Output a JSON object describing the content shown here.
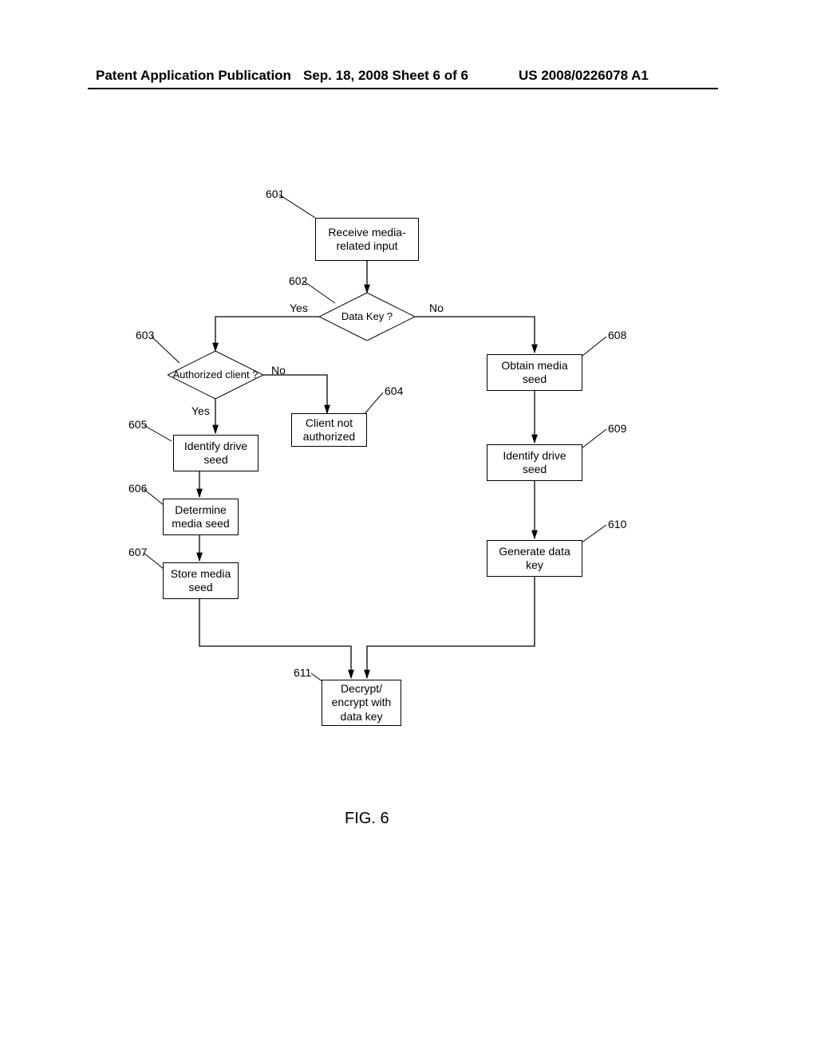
{
  "header": {
    "left": "Patent Application Publication",
    "center": "Sep. 18, 2008  Sheet 6 of 6",
    "right": "US 2008/0226078 A1"
  },
  "nodes": {
    "n601": "Receive media-related input",
    "n602": "Data Key ?",
    "n603": "Authorized client ?",
    "n604": "Client not authorized",
    "n605": "Identify drive seed",
    "n606": "Determine media seed",
    "n607": "Store media seed",
    "n608": "Obtain media seed",
    "n609": "Identify drive seed",
    "n610": "Generate data key",
    "n611": "Decrypt/ encrypt with data key"
  },
  "labels": {
    "l601": "601",
    "l602": "602",
    "l603": "603",
    "l604": "604",
    "l605": "605",
    "l606": "606",
    "l607": "607",
    "l608": "608",
    "l609": "609",
    "l610": "610",
    "l611": "611",
    "yes1": "Yes",
    "no1": "No",
    "yes2": "Yes",
    "no2": "No"
  },
  "figcaption": "FIG. 6",
  "chart_data": {
    "type": "flowchart",
    "title": "FIG. 6",
    "nodes": [
      {
        "id": "601",
        "label": "Receive media-related input",
        "shape": "process"
      },
      {
        "id": "602",
        "label": "Data Key ?",
        "shape": "decision"
      },
      {
        "id": "603",
        "label": "Authorized client ?",
        "shape": "decision"
      },
      {
        "id": "604",
        "label": "Client not authorized",
        "shape": "process"
      },
      {
        "id": "605",
        "label": "Identify drive seed",
        "shape": "process"
      },
      {
        "id": "606",
        "label": "Determine media seed",
        "shape": "process"
      },
      {
        "id": "607",
        "label": "Store media seed",
        "shape": "process"
      },
      {
        "id": "608",
        "label": "Obtain media seed",
        "shape": "process"
      },
      {
        "id": "609",
        "label": "Identify drive seed",
        "shape": "process"
      },
      {
        "id": "610",
        "label": "Generate data key",
        "shape": "process"
      },
      {
        "id": "611",
        "label": "Decrypt/encrypt with data key",
        "shape": "process"
      }
    ],
    "edges": [
      {
        "from": "601",
        "to": "602"
      },
      {
        "from": "602",
        "to": "603",
        "label": "Yes"
      },
      {
        "from": "602",
        "to": "608",
        "label": "No"
      },
      {
        "from": "603",
        "to": "605",
        "label": "Yes"
      },
      {
        "from": "603",
        "to": "604",
        "label": "No"
      },
      {
        "from": "605",
        "to": "606"
      },
      {
        "from": "606",
        "to": "607"
      },
      {
        "from": "607",
        "to": "611"
      },
      {
        "from": "608",
        "to": "609"
      },
      {
        "from": "609",
        "to": "610"
      },
      {
        "from": "610",
        "to": "611"
      }
    ]
  }
}
